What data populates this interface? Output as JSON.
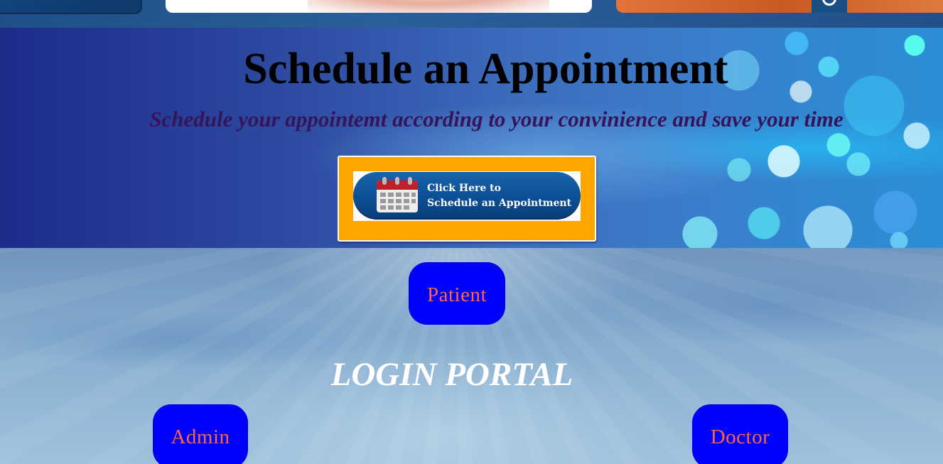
{
  "schedule": {
    "title": "Schedule an Appointment",
    "subtitle": "Schedule your appointemt according to your convinience and save your time",
    "cta": {
      "line1": "Click Here to",
      "line2": "Schedule an Appointment",
      "icon": "calendar-icon",
      "background_color": "#ffa500"
    }
  },
  "login": {
    "title": "LOGIN PORTAL",
    "patient_label": "Patient",
    "admin_label": "Admin",
    "doctor_label": "Doctor",
    "button_color": "#0000ff",
    "button_text_color": "#ff6347"
  }
}
